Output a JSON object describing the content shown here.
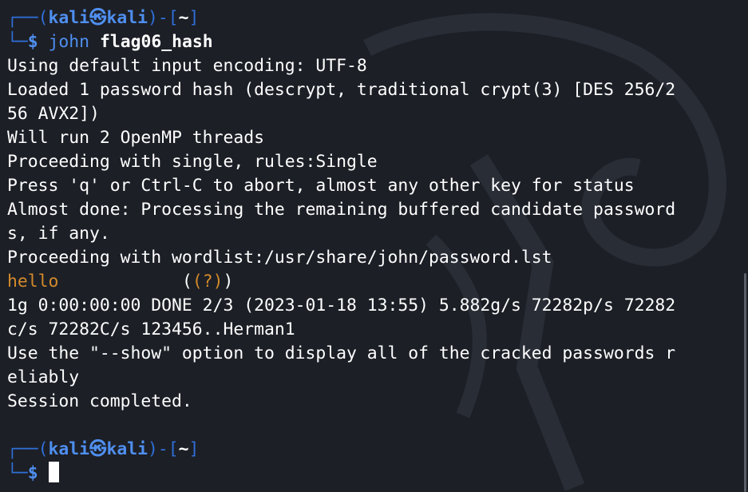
{
  "prompt_top": {
    "corner_top": "┌──",
    "open_paren": "(",
    "user": "kali",
    "at_symbol": "㉿",
    "host": "kali",
    "close_paren": ")",
    "sep": "-[",
    "dir": "~",
    "dir_close": "]",
    "corner_bottom": "└─",
    "dollar": "$",
    "command": "john",
    "argument": "flag06_hash"
  },
  "output": [
    "Using default input encoding: UTF-8",
    "Loaded 1 password hash (descrypt, traditional crypt(3) [DES 256/2",
    "56 AVX2])",
    "Will run 2 OpenMP threads",
    "Proceeding with single, rules:Single",
    "Press 'q' or Ctrl-C to abort, almost any other key for status",
    "Almost done: Processing the remaining buffered candidate password",
    "s, if any.",
    "Proceeding with wordlist:/usr/share/john/password.lst"
  ],
  "cracked": {
    "password": "hello",
    "user_marker": "(?)"
  },
  "output2": [
    "1g 0:00:00:00 DONE 2/3 (2023-01-18 13:55) 5.882g/s 72282p/s 72282",
    "c/s 72282C/s 123456..Herman1",
    "Use the \"--show\" option to display all of the cracked passwords r",
    "eliably",
    "Session completed."
  ],
  "prompt_bottom": {
    "corner_top": "┌──",
    "open_paren": "(",
    "user": "kali",
    "at_symbol": "㉿",
    "host": "kali",
    "close_paren": ")",
    "sep": "-[",
    "dir": "~",
    "dir_close": "]",
    "corner_bottom": "└─",
    "dollar": "$"
  },
  "colors": {
    "background": "#1c1f26",
    "prompt_blue": "#4f8ff0",
    "cracked_orange": "#d38a2a",
    "text": "#ffffff"
  }
}
